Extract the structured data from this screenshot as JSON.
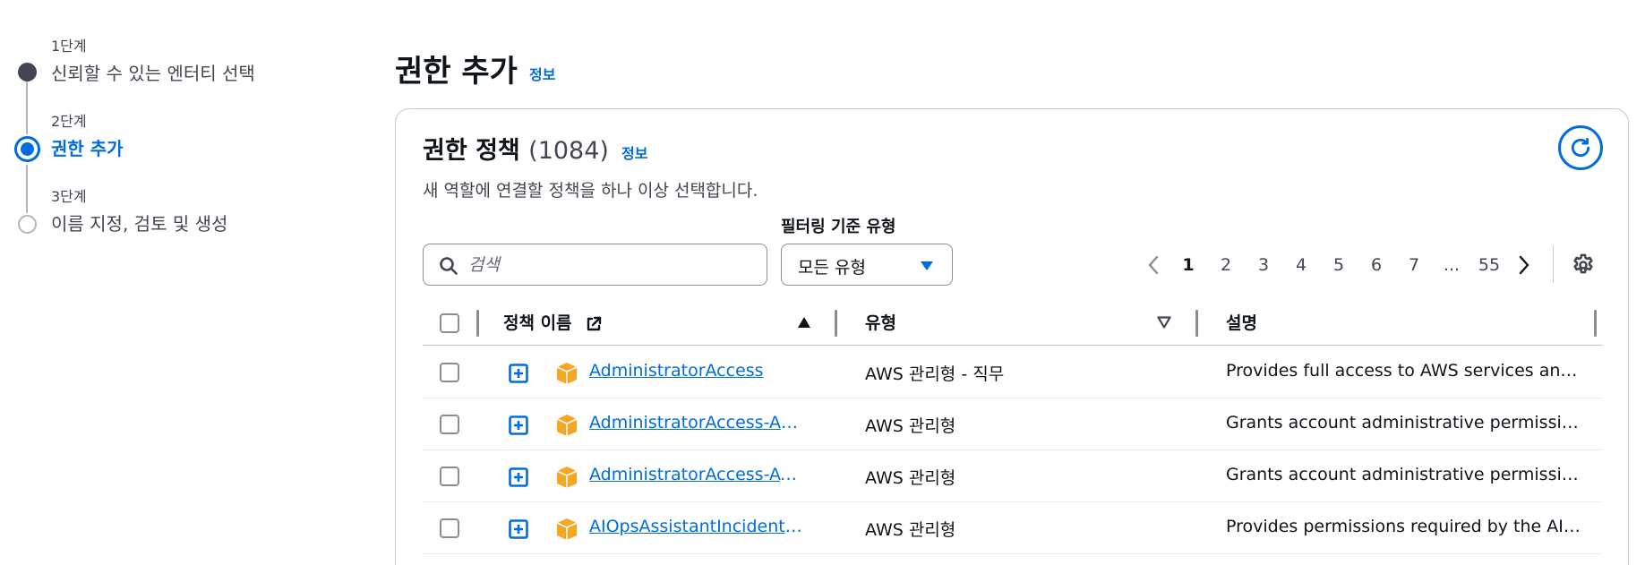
{
  "wizard": {
    "steps": [
      {
        "number": "1단계",
        "title": "신뢰할 수 있는 엔터티 선택",
        "state": "done"
      },
      {
        "number": "2단계",
        "title": "권한 추가",
        "state": "current"
      },
      {
        "number": "3단계",
        "title": "이름 지정, 검토 및 생성",
        "state": "next"
      }
    ]
  },
  "header": {
    "title": "권한 추가",
    "info": "정보"
  },
  "panel": {
    "title": "권한 정책",
    "count": "(1084)",
    "info": "정보",
    "description": "새 역할에 연결할 정책을 하나 이상 선택합니다."
  },
  "filters": {
    "search_placeholder": "검색",
    "type_label": "필터링 기준 유형",
    "type_value": "모든 유형"
  },
  "pagination": {
    "pages": [
      "1",
      "2",
      "3",
      "4",
      "5",
      "6",
      "7",
      "...",
      "55"
    ],
    "current": "1"
  },
  "table": {
    "columns": {
      "name": "정책 이름",
      "type": "유형",
      "description": "설명"
    },
    "rows": [
      {
        "name": "AdministratorAccess",
        "type": "AWS 관리형 - 직무",
        "description": "Provides full access to AWS services and resources."
      },
      {
        "name": "AdministratorAccess-Amplify",
        "type": "AWS 관리형",
        "description": "Grants account administrative permissions while explicitly allowing direct access to resources needed by Amplify applications."
      },
      {
        "name": "AdministratorAccess-AWSElasticBeanstalk",
        "type": "AWS 관리형",
        "description": "Grants account administrative permissions. Explicitly allows developers and administrators to gain direct access to resources."
      },
      {
        "name": "AIOpsAssistantIncidentReportPolicy",
        "type": "AWS 관리형",
        "description": "Provides permissions required by the AIOps assistant."
      }
    ]
  },
  "colors": {
    "accent": "#006ce0",
    "text": "#0f141a",
    "secondary_text": "#424650",
    "border": "#c6c6cd",
    "cube": "#f5a623"
  }
}
